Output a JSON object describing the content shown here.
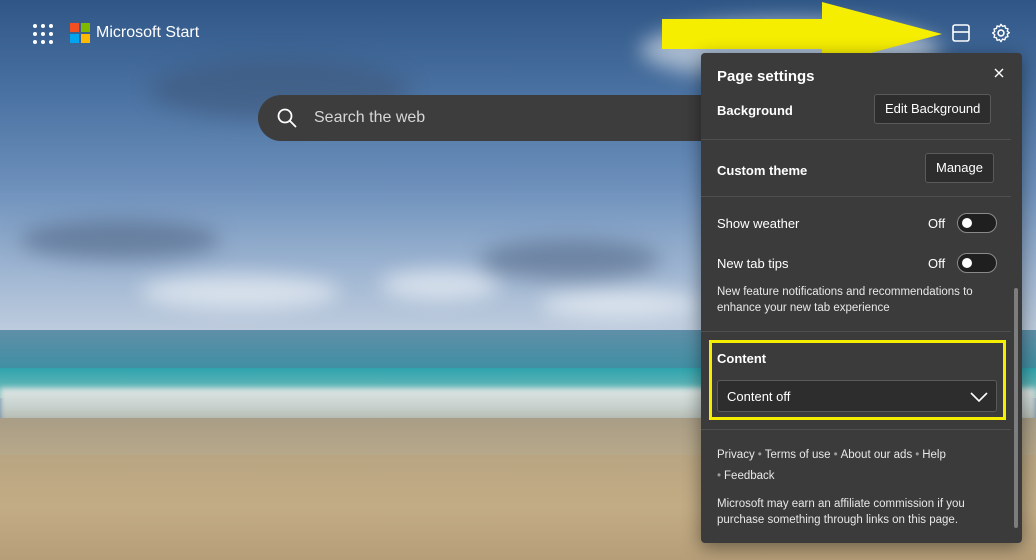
{
  "brand": {
    "name": "Microsoft Start",
    "logo_colors": [
      "#f25022",
      "#7fba00",
      "#00a4ef",
      "#ffb900"
    ]
  },
  "search": {
    "placeholder": "Search the web"
  },
  "annotation": {
    "arrow_color": "#f5ee00",
    "highlight_color": "#f5ee00"
  },
  "page_settings": {
    "title": "Page settings",
    "background": {
      "label": "Background",
      "button": "Edit Background"
    },
    "custom_theme": {
      "label": "Custom theme",
      "button": "Manage"
    },
    "show_weather": {
      "label": "Show weather",
      "state": "Off"
    },
    "new_tab_tips": {
      "label": "New tab tips",
      "state": "Off",
      "description": "New feature notifications and recommendations to enhance your new tab experience"
    },
    "content": {
      "label": "Content",
      "selected": "Content off"
    },
    "footer_links": [
      "Privacy",
      "Terms of use",
      "About our ads",
      "Help",
      "Feedback"
    ],
    "affiliate_note": "Microsoft may earn an affiliate commission if you purchase something through links on this page."
  }
}
